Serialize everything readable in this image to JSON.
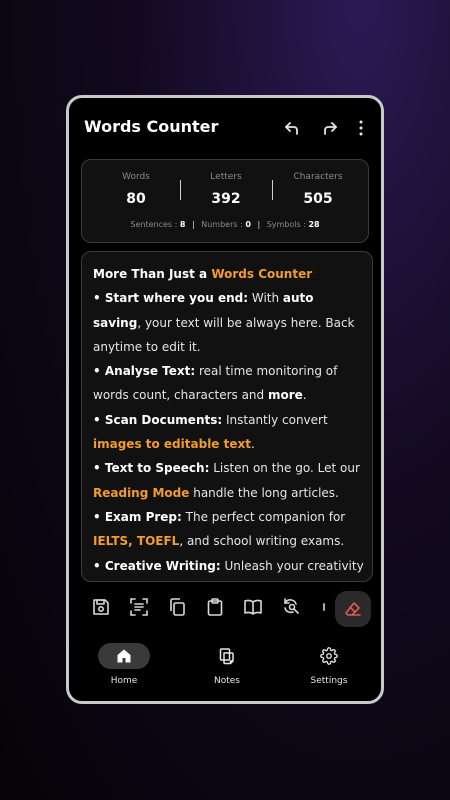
{
  "app": {
    "title": "Words Counter"
  },
  "stats": {
    "words": {
      "label": "Words",
      "value": "80"
    },
    "letters": {
      "label": "Letters",
      "value": "392"
    },
    "characters": {
      "label": "Characters",
      "value": "505"
    },
    "sentences": {
      "label": "Sentences :",
      "value": "8"
    },
    "numbers": {
      "label": "Numbers :",
      "value": "0"
    },
    "symbols": {
      "label": "Symbols :",
      "value": "28"
    },
    "separator": "|"
  },
  "editor": {
    "intro": "More Than Just a ",
    "intro_hl": "Words Counter",
    "bullet": "• ",
    "p1_b": "Start where you end:",
    "p1_a": " With ",
    "p1_b2": "auto saving",
    "p1_c": ", your text will be always here. Back anytime to edit it.",
    "p2_b": "Analyse Text:",
    "p2_a": " real time monitoring of words count, characters and ",
    "p2_b2": "more",
    "p2_c": ".",
    "p3_b": "Scan Documents:",
    "p3_a": " Instantly convert ",
    "p3_hl": "images to editable text",
    "p3_c": ".",
    "p4_b": "Text to Speech:",
    "p4_a": " Listen on the go. Let our ",
    "p4_hl": "Reading Mode",
    "p4_c": " handle the long articles.",
    "p5_b": "Exam Prep:",
    "p5_a": " The perfect companion for ",
    "p5_hl1": "IELTS, TOEFL",
    "p5_c": ", and school writing exams.",
    "p6_b": "Creative Writing:",
    "p6_a": " Unleash your creativity and build your next masterpiece."
  },
  "toolbar": {
    "icons": [
      "save-icon",
      "scan-document-icon",
      "copy-icon",
      "paste-icon",
      "reading-mode-icon",
      "find-replace-icon",
      "clear-text-icon"
    ]
  },
  "nav": {
    "home": "Home",
    "notes": "Notes",
    "settings": "Settings"
  },
  "colors": {
    "accent": "#f39c2b",
    "card": "#111111",
    "frame": "#c9c9c9"
  }
}
